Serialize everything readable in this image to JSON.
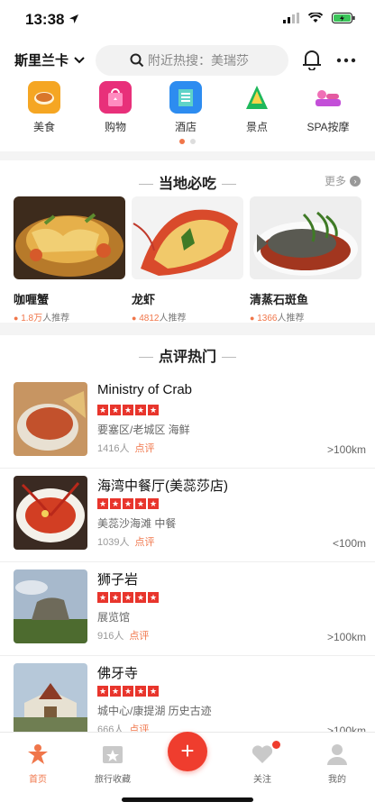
{
  "status": {
    "time": "13:38"
  },
  "header": {
    "city": "斯里兰卡",
    "search_placeholder": "附近热搜：美瑞莎"
  },
  "categories": [
    {
      "label": "美食",
      "icon": "chicken-icon",
      "color": "#f5a623"
    },
    {
      "label": "购物",
      "icon": "shopping-bag-icon",
      "color": "#e8307a"
    },
    {
      "label": "酒店",
      "icon": "hotel-icon",
      "color": "#2d8cf0"
    },
    {
      "label": "景点",
      "icon": "mountain-icon",
      "color": "#1fb85b"
    },
    {
      "label": "SPA按摩",
      "icon": "spa-icon",
      "color": "#c34fd8"
    }
  ],
  "must_eat": {
    "title": "当地必吃",
    "more": "更多",
    "items": [
      {
        "name": "咖喱蟹",
        "count": "1.8万",
        "suffix": "人推荐"
      },
      {
        "name": "龙虾",
        "count": "4812",
        "suffix": "人推荐"
      },
      {
        "name": "清蒸石斑鱼",
        "count": "1366",
        "suffix": "人推荐"
      }
    ]
  },
  "popular": {
    "title": "点评热门",
    "review_label": "点评",
    "items": [
      {
        "name": "Ministry of Crab",
        "tags": "要塞区/老城区  海鲜",
        "count": "1416人",
        "dist": ">100km"
      },
      {
        "name": "海湾中餐厅(美蕊莎店)",
        "tags": "美蕊沙海滩  中餐",
        "count": "1039人",
        "dist": "<100m"
      },
      {
        "name": "狮子岩",
        "tags": "展览馆",
        "count": "916人",
        "dist": ">100km"
      },
      {
        "name": "佛牙寺",
        "tags": "城中心/康提湖  历史古迹",
        "count": "666人",
        "dist": ">100km"
      }
    ]
  },
  "tabbar": {
    "home": "首页",
    "favorites": "旅行收藏",
    "follow": "关注",
    "mine": "我的",
    "fab": "+"
  },
  "colors": {
    "accent": "#f0764a",
    "star": "#e8352c"
  }
}
